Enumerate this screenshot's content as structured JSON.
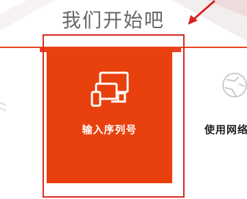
{
  "header": {
    "title": "我们开始吧"
  },
  "tiles": [
    {
      "label": "输入序列号",
      "icon": "devices-icon",
      "selected": true
    },
    {
      "label": "使用网络",
      "icon": "globe-icon",
      "selected": false
    }
  ],
  "colors": {
    "accent": "#e9410e",
    "highlight": "#d9231f",
    "title": "#666666"
  }
}
